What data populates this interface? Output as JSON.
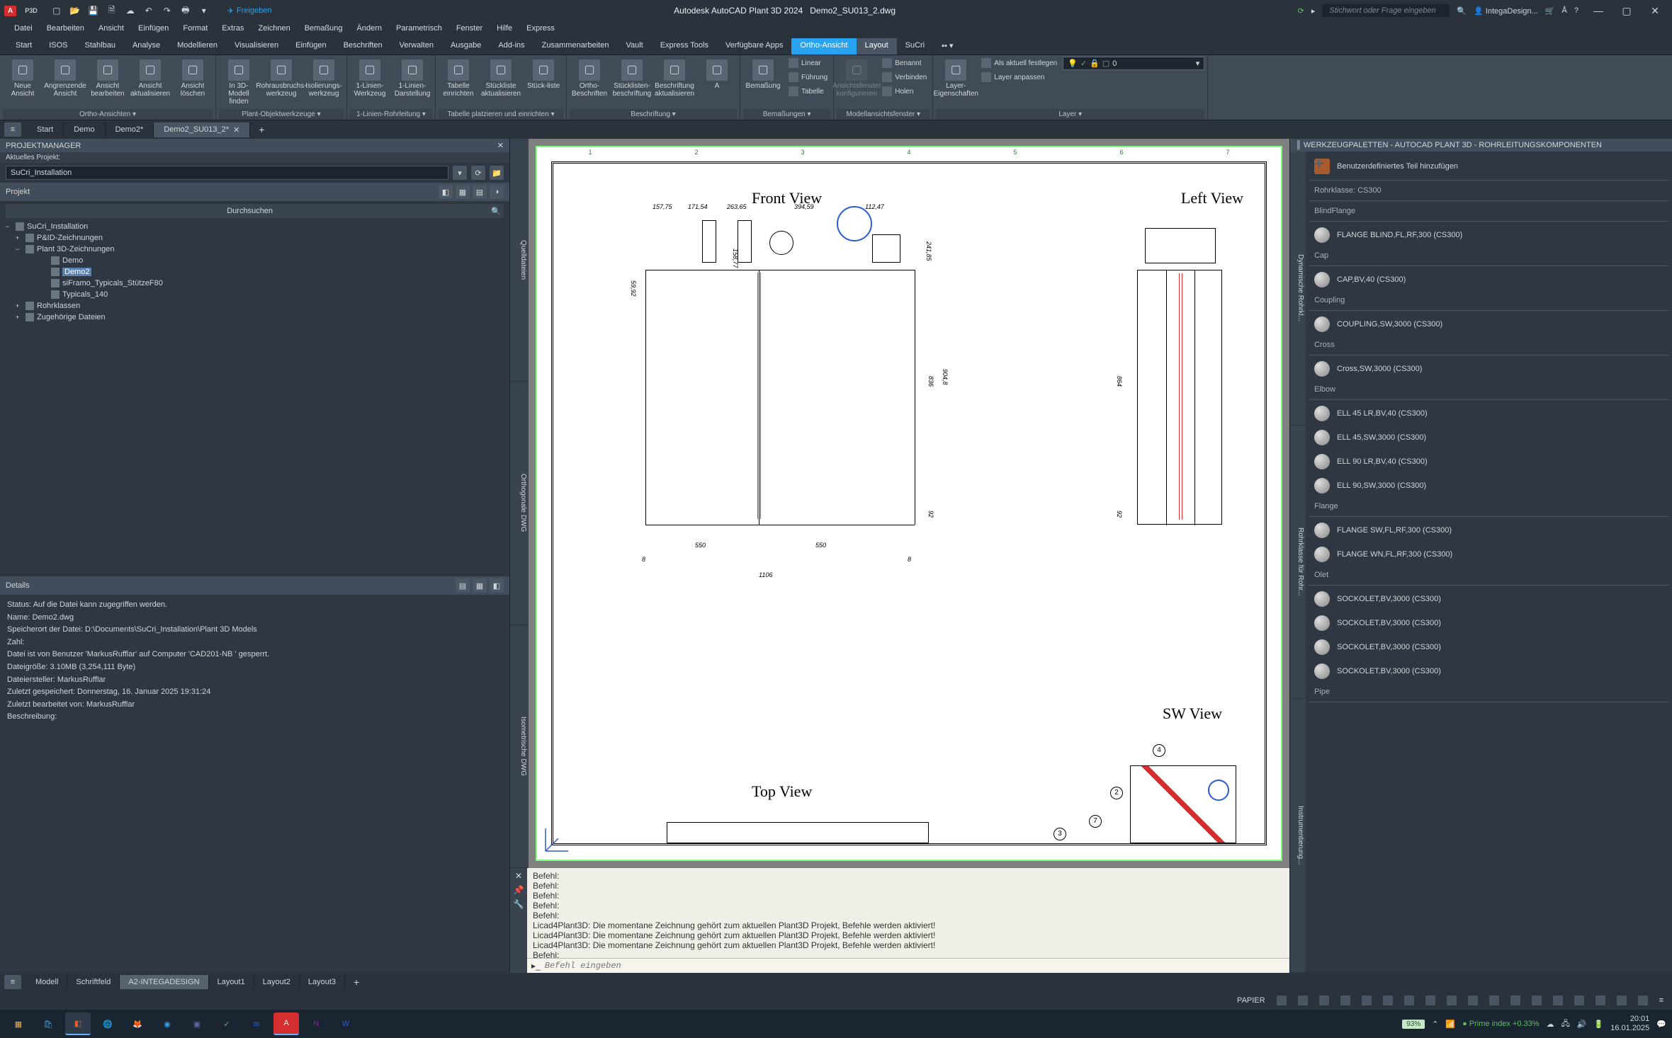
{
  "app": {
    "title": "Autodesk AutoCAD Plant 3D 2024",
    "filename": "Demo2_SU013_2.dwg",
    "search_placeholder": "Stichwort oder Frage eingeben",
    "user": "IntegaDesign...",
    "share": "Freigeben",
    "pro": "P3D"
  },
  "menubar": [
    "Datei",
    "Bearbeiten",
    "Ansicht",
    "Einfügen",
    "Format",
    "Extras",
    "Zeichnen",
    "Bemaßung",
    "Ändern",
    "Parametrisch",
    "Fenster",
    "Hilfe",
    "Express"
  ],
  "ribbon_tabs": [
    {
      "label": "Start"
    },
    {
      "label": "ISOS"
    },
    {
      "label": "Stahlbau"
    },
    {
      "label": "Analyse"
    },
    {
      "label": "Modellieren"
    },
    {
      "label": "Visualisieren"
    },
    {
      "label": "Einfügen"
    },
    {
      "label": "Beschriften"
    },
    {
      "label": "Verwalten"
    },
    {
      "label": "Ausgabe"
    },
    {
      "label": "Add-ins"
    },
    {
      "label": "Zusammenarbeiten"
    },
    {
      "label": "Vault"
    },
    {
      "label": "Express Tools"
    },
    {
      "label": "Verfügbare Apps"
    },
    {
      "label": "Ortho-Ansicht",
      "active": true
    },
    {
      "label": "Layout",
      "active2": true
    },
    {
      "label": "SuCri"
    }
  ],
  "ribbon": {
    "panels": [
      {
        "title": "Ortho-Ansichten",
        "items": [
          {
            "label": "Neue Ansicht"
          },
          {
            "label": "Angrenzende Ansicht"
          },
          {
            "label": "Ansicht bearbeiten"
          },
          {
            "label": "Ansicht aktualisieren"
          },
          {
            "label": "Ansicht löschen"
          }
        ]
      },
      {
        "title": "Plant-Objektwerkzeuge",
        "items": [
          {
            "label": "In 3D-Modell finden"
          },
          {
            "label": "Rohrausbruchs-werkzeug"
          },
          {
            "label": "Isolierungs-werkzeug"
          }
        ]
      },
      {
        "title": "1-Linien-Rohrleitung",
        "items": [
          {
            "label": "1-Linien-Werkzeug"
          },
          {
            "label": "1-Linien-Darstellung"
          }
        ]
      },
      {
        "title": "Tabelle platzieren und einrichten",
        "items": [
          {
            "label": "Tabelle einrichten"
          },
          {
            "label": "Stückliste aktualisieren"
          },
          {
            "label": "Stück-liste"
          }
        ]
      },
      {
        "title": "Beschriftung",
        "items": [
          {
            "label": "Ortho-Beschriften"
          },
          {
            "label": "Stücklisten-beschriftung"
          },
          {
            "label": "Beschriftung aktualisieren"
          },
          {
            "label": "A"
          }
        ]
      },
      {
        "title": "Bemaßungen",
        "items": [
          {
            "label": "Bemaßung"
          },
          {
            "small": [
              {
                "label": "Linear"
              },
              {
                "label": "Führung"
              },
              {
                "label": "Tabelle"
              }
            ]
          }
        ]
      },
      {
        "title": "Modellansichtsfenster",
        "items": [
          {
            "label": "Ansichtsfenster konfigurieren",
            "disabled": true
          },
          {
            "small": [
              {
                "label": "Benannt"
              },
              {
                "label": "Verbinden"
              },
              {
                "label": "Holen"
              }
            ]
          }
        ]
      },
      {
        "title": "",
        "items": [
          {
            "label": "Layer-Eigenschaften"
          },
          {
            "small": [
              {
                "label": "Als aktuell festlegen"
              },
              {
                "label": "Layer anpassen"
              }
            ]
          },
          {
            "layer_field": "0"
          }
        ],
        "title2": "Layer"
      }
    ]
  },
  "doctabs": [
    {
      "label": "Start"
    },
    {
      "label": "Demo"
    },
    {
      "label": "Demo2*"
    },
    {
      "label": "Demo2_SU013_2*",
      "active": true
    }
  ],
  "project": {
    "manager_title": "PROJEKTMANAGER",
    "current_label": "Aktuelles Projekt:",
    "current_value": "SuCri_Installation",
    "section": "Projekt",
    "search": "Durchsuchen",
    "tree": [
      {
        "label": "SuCri_Installation",
        "exp": "−",
        "lv": 0
      },
      {
        "label": "P&ID-Zeichnungen",
        "exp": "+",
        "lv": 1
      },
      {
        "label": "Plant 3D-Zeichnungen",
        "exp": "−",
        "lv": 1
      },
      {
        "label": "Demo",
        "lv": 3
      },
      {
        "label": "Demo2",
        "lv": 3,
        "sel": true
      },
      {
        "label": "siFramo_Typicals_StützeF80",
        "lv": 3
      },
      {
        "label": "Typicals_140",
        "lv": 3
      },
      {
        "label": "Rohrklassen",
        "exp": "+",
        "lv": 1
      },
      {
        "label": "Zugehörige Dateien",
        "exp": "+",
        "lv": 1
      }
    ],
    "details_title": "Details",
    "details": [
      "Status: Auf die Datei kann zugegriffen werden.",
      "Name: Demo2.dwg",
      "Speicherort der Datei: D:\\Documents\\SuCri_Installation\\Plant 3D Models",
      "Zahl:",
      "Datei ist von Benutzer 'MarkusRufflar' auf Computer 'CAD201-NB ' gesperrt.",
      "Dateigröße: 3.10MB (3,254,111 Byte)",
      "Dateiersteller: MarkusRufflar",
      "Zuletzt gespeichert: Donnerstag, 16. Januar 2025 19:31:24",
      "Zuletzt bearbeitet von: MarkusRufflar",
      "Beschreibung:"
    ]
  },
  "side_tabs": [
    "Quelldateien",
    "Orthogonale DWG",
    "Isometrische DWG"
  ],
  "drawing": {
    "views": {
      "front": "Front View",
      "left": "Left View",
      "top": "Top View",
      "sw": "SW View"
    },
    "dims": {
      "d1": "157,75",
      "d2": "171,54",
      "d3": "263,65",
      "d4": "394,59",
      "d5": "112,47",
      "h1": "59,92",
      "h2": "158,77",
      "h3": "241,85",
      "h4": "836",
      "h5": "904,8",
      "h6": "92",
      "w1": "550",
      "w2": "550",
      "w3": "1106",
      "w4": "8",
      "w5": "8",
      "lh": "864",
      "lh2": "92"
    },
    "balloons": {
      "b1": "2",
      "b2": "4",
      "b3": "7",
      "b4": "3"
    }
  },
  "cmd": {
    "lines": [
      "Befehl:",
      "Befehl:",
      "Befehl:",
      "Befehl:",
      "Befehl:",
      "Licad4Plant3D: Die momentane Zeichnung gehört zum aktuellen Plant3D Projekt, Befehle werden aktiviert!",
      "Licad4Plant3D: Die momentane Zeichnung gehört zum aktuellen Plant3D Projekt, Befehle werden aktiviert!",
      "Licad4Plant3D: Die momentane Zeichnung gehört zum aktuellen Plant3D Projekt, Befehle werden aktiviert!",
      "Befehl:"
    ],
    "placeholder": "Befehl eingeben"
  },
  "palette": {
    "title": "WERKZEUGPALETTEN - AUTOCAD PLANT 3D - ROHRLEITUNGSKOMPONENTEN",
    "add_custom": "Benutzerdefiniertes Teil hinzufügen",
    "pipe_class": "Rohrklasse: CS300",
    "side_tabs": [
      "Dynamische Rohrkl...",
      "Rohrklasse für Rohr...",
      "Instrumentierung..."
    ],
    "groups": [
      {
        "name": "BlindFlange",
        "items": [
          "FLANGE BLIND,FL,RF,300 (CS300)"
        ]
      },
      {
        "name": "Cap",
        "items": [
          "CAP,BV,40 (CS300)"
        ]
      },
      {
        "name": "Coupling",
        "items": [
          "COUPLING,SW,3000 (CS300)"
        ]
      },
      {
        "name": "Cross",
        "items": [
          "Cross,SW,3000 (CS300)"
        ]
      },
      {
        "name": "Elbow",
        "items": [
          "ELL 45 LR,BV,40 (CS300)",
          "ELL 45,SW,3000 (CS300)",
          "ELL 90 LR,BV,40 (CS300)",
          "ELL 90,SW,3000 (CS300)"
        ]
      },
      {
        "name": "Flange",
        "items": [
          "FLANGE SW,FL,RF,300 (CS300)",
          "FLANGE WN,FL,RF,300 (CS300)"
        ]
      },
      {
        "name": "Olet",
        "items": [
          "SOCKOLET,BV,3000 (CS300)",
          "SOCKOLET,BV,3000 (CS300)",
          "SOCKOLET,BV,3000 (CS300)",
          "SOCKOLET,BV,3000 (CS300)"
        ]
      },
      {
        "name": "Pipe",
        "items": []
      }
    ]
  },
  "layout_tabs": [
    "Modell",
    "Schriftfeld",
    "A2-INTEGADESIGN",
    "Layout1",
    "Layout2",
    "Layout3"
  ],
  "layout_active": "A2-INTEGADESIGN",
  "status": {
    "paper": "PAPIER",
    "zoom": "93%",
    "prime": "Prime index",
    "prime_val": "+0.33%",
    "time": "20:01",
    "date": "16.01.2025"
  }
}
